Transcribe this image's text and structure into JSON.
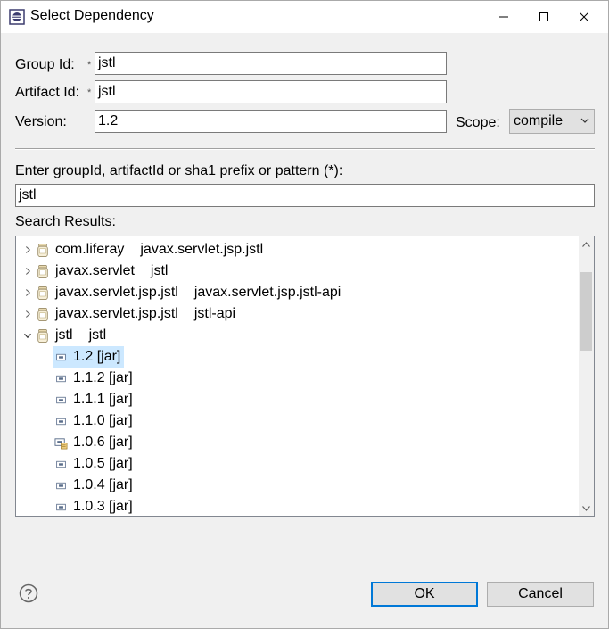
{
  "window": {
    "title": "Select Dependency"
  },
  "form": {
    "group_id_label": "Group Id:",
    "group_id_value": "jstl",
    "artifact_id_label": "Artifact Id:",
    "artifact_id_value": "jstl",
    "version_label": "Version:",
    "version_value": "1.2",
    "scope_label": "Scope:",
    "scope_value": "compile",
    "required_marker": "*"
  },
  "search": {
    "prompt": "Enter groupId, artifactId or sha1 prefix or pattern (*):",
    "query": "jstl",
    "results_label": "Search Results:"
  },
  "results": [
    {
      "group": "com.liferay",
      "artifact": "javax.servlet.jsp.jstl",
      "expanded": false
    },
    {
      "group": "javax.servlet",
      "artifact": "jstl",
      "expanded": false
    },
    {
      "group": "javax.servlet.jsp.jstl",
      "artifact": "javax.servlet.jsp.jstl-api",
      "expanded": false
    },
    {
      "group": "javax.servlet.jsp.jstl",
      "artifact": "jstl-api",
      "expanded": false
    },
    {
      "group": "jstl",
      "artifact": "jstl",
      "expanded": true
    }
  ],
  "versions": [
    {
      "label": "1.2 [jar]",
      "selected": true,
      "icon": "jar-icon"
    },
    {
      "label": "1.1.2 [jar]",
      "selected": false,
      "icon": "jar-icon"
    },
    {
      "label": "1.1.1 [jar]",
      "selected": false,
      "icon": "jar-icon"
    },
    {
      "label": "1.1.0 [jar]",
      "selected": false,
      "icon": "jar-icon"
    },
    {
      "label": "1.0.6 [jar]",
      "selected": false,
      "icon": "jar-source-icon"
    },
    {
      "label": "1.0.5 [jar]",
      "selected": false,
      "icon": "jar-icon"
    },
    {
      "label": "1.0.4 [jar]",
      "selected": false,
      "icon": "jar-icon"
    },
    {
      "label": "1.0.3 [jar]",
      "selected": false,
      "icon": "jar-icon"
    }
  ],
  "buttons": {
    "ok": "OK",
    "cancel": "Cancel"
  },
  "colors": {
    "selection": "#cce8ff",
    "default_button_border": "#0078d7"
  }
}
